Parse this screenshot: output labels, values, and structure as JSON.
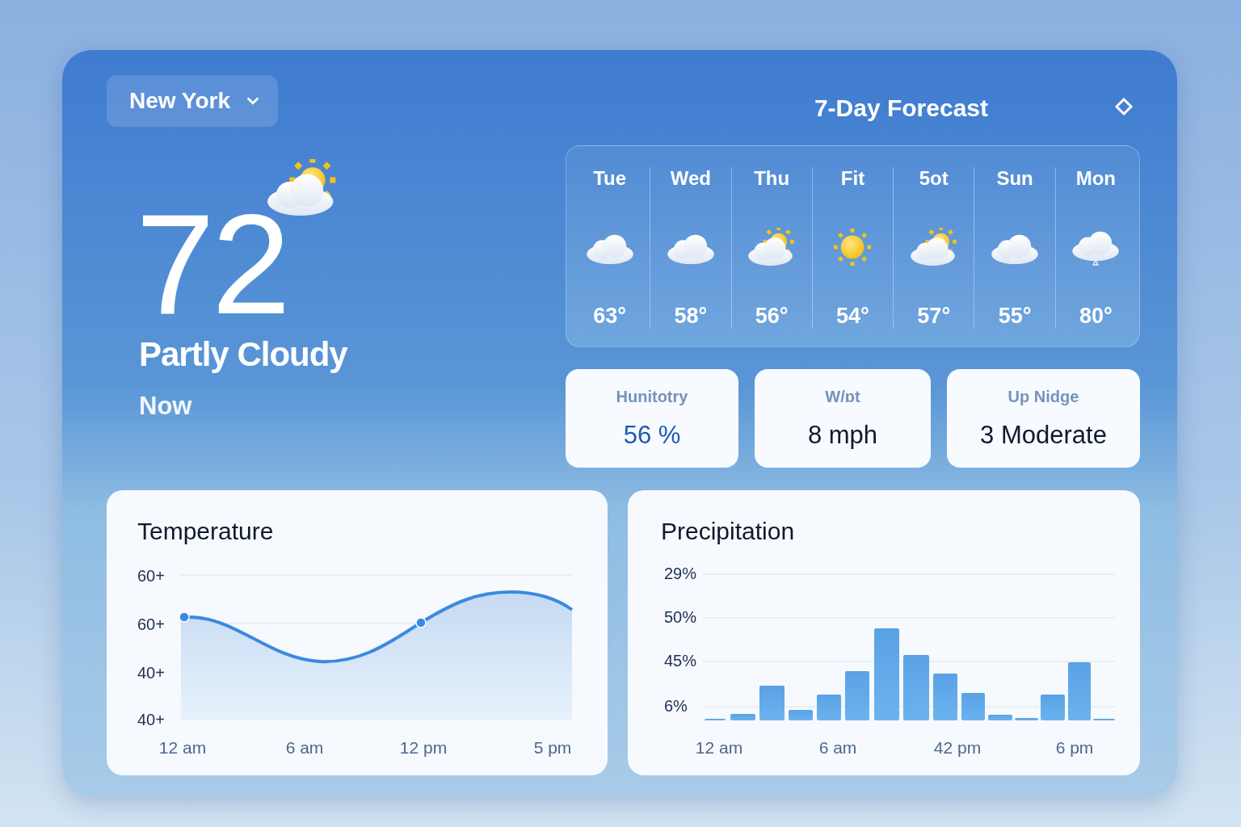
{
  "location": {
    "value": "New York"
  },
  "current": {
    "temperature": "72",
    "condition": "Partly Cloudy",
    "kind": "partly-cloudy",
    "time": "Now"
  },
  "forecast": {
    "title": "7-Day Forecast",
    "days": [
      {
        "day": "Tue",
        "kind": "cloudy",
        "temp": "63°"
      },
      {
        "day": "Wed",
        "kind": "cloudy",
        "temp": "58°"
      },
      {
        "day": "Thu",
        "kind": "partly-cloudy",
        "temp": "56°"
      },
      {
        "day": "Fit",
        "kind": "sunny",
        "temp": "54°"
      },
      {
        "day": "5ot",
        "kind": "partly-cloudy",
        "temp": "57°"
      },
      {
        "day": "Sun",
        "kind": "cloudy",
        "temp": "55°"
      },
      {
        "day": "Mon",
        "kind": "rain",
        "temp": "80°"
      }
    ]
  },
  "stats": [
    {
      "label": "Hunitotry",
      "value": "56 %",
      "color": "#1d5bb0"
    },
    {
      "label": "W/ɒt",
      "value": "8 mph",
      "color": "#0f1a2e"
    },
    {
      "label": "Up Nidge",
      "value": "3 Moderate",
      "color": "#0f1a2e"
    }
  ],
  "temperature_panel": {
    "title": "Temperature",
    "y_labels": [
      "60+",
      "60+",
      "40+",
      "40+"
    ],
    "x_labels": [
      "12 am",
      "6 am",
      "12 pm",
      "5 pm"
    ]
  },
  "precipitation_panel": {
    "title": "Precipitation",
    "y_labels": [
      "29%",
      "50%",
      "45%",
      "6%"
    ],
    "x_labels": [
      "12 am",
      "6 am",
      "42 pm",
      "6 pm"
    ]
  }
}
